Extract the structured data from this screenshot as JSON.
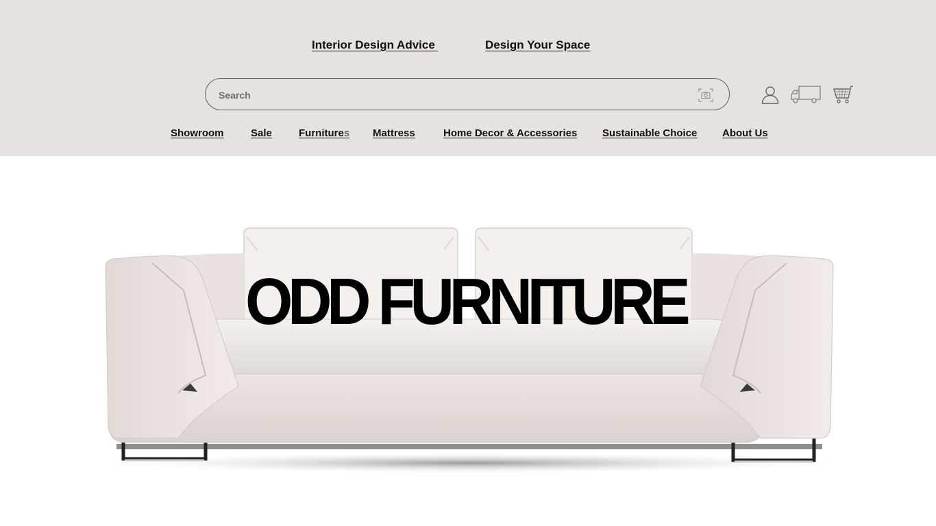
{
  "top_links": {
    "interior_design_advice": "Interior Design Advice ",
    "design_your_space": "Design Your Space"
  },
  "search": {
    "placeholder": "Search",
    "value": ""
  },
  "header_icons": [
    "user-icon",
    "delivery-truck-icon",
    "shopping-cart-icon",
    "camera-search-icon"
  ],
  "nav": {
    "items": [
      {
        "label": "Showroom"
      },
      {
        "label": "Sale"
      },
      {
        "label": "Furniture",
        "suffix": "s"
      },
      {
        "label": "Mattress"
      },
      {
        "label": "Home Decor & Accessories"
      },
      {
        "label": "Sustainable Choice"
      },
      {
        "label": "About Us"
      }
    ]
  },
  "hero": {
    "brand": "ODD FURNITURE"
  },
  "colors": {
    "header_bg": "#e4e3e2",
    "text": "#111111",
    "sofa": "#e9e4e1"
  }
}
